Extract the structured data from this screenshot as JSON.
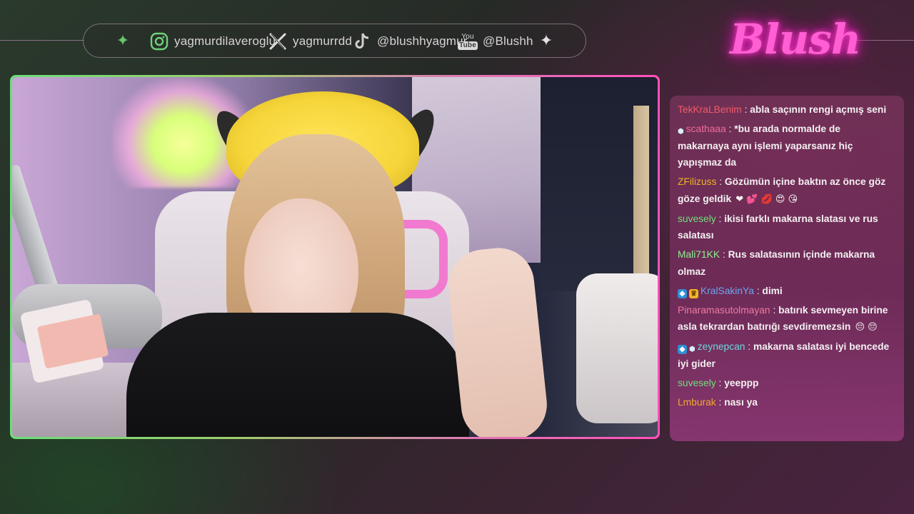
{
  "socials": {
    "instagram": "yagmurdilaveroglu",
    "x": "yagmurrdd",
    "tiktok": "@blushhyagmur",
    "youtube_logo_you": "You",
    "youtube_logo_tube": "Tube",
    "youtube": "@Blushh"
  },
  "logo": {
    "text": "Blush"
  },
  "colors": {
    "accent_green": "#67c56a",
    "accent_pink": "#ff5fd2",
    "chat_bg": "#7a2f63"
  },
  "chat": {
    "messages": [
      {
        "user": "TekKraLBenim",
        "color": "#f25a6a",
        "text": "abla saçının rengi açmış seni",
        "badges": [],
        "emojis": ""
      },
      {
        "user": "scathaaa",
        "color": "#f06a9a",
        "text": "*bu arada normalde de makarnaya aynı işlemi yaparsanız hiç yapışmaz da",
        "badges": [
          "gem"
        ],
        "emojis": ""
      },
      {
        "user": "ZFilizuss",
        "color": "#f0b428",
        "text": "Gözümün içine baktın az önce göz göze geldik",
        "badges": [],
        "emojis": "❤ 💕 💋 😍 😘"
      },
      {
        "user": "suvesely",
        "color": "#6fe07a",
        "text": "ikisi farklı makarna slatası ve rus salatası",
        "badges": [],
        "emojis": ""
      },
      {
        "user": "Mali71KK",
        "color": "#8ef08e",
        "text": "Rus salatasının içinde makarna olmaz",
        "badges": [],
        "emojis": ""
      },
      {
        "user": "KralSakinYa",
        "color": "#6aa8f0",
        "text": "dimi",
        "badges": [
          "sub",
          "crown"
        ],
        "emojis": ""
      },
      {
        "user": "Pinaramasutolmayan",
        "color": "#f07aa0",
        "text": "batırık sevmeyen birine asla tekrardan batırığı sevdiremezsin",
        "badges": [],
        "emojis": "😔 😔"
      },
      {
        "user": "zeynepcan",
        "color": "#6ad8d8",
        "text": "makarna salatası iyi bencede iyi gider",
        "badges": [
          "sub",
          "gem"
        ],
        "emojis": ""
      },
      {
        "user": "suvesely",
        "color": "#6fe07a",
        "text": "yeeppp",
        "badges": [],
        "emojis": ""
      },
      {
        "user": "Lmburak",
        "color": "#f0a830",
        "text": "nası ya",
        "badges": [],
        "emojis": ""
      }
    ]
  }
}
